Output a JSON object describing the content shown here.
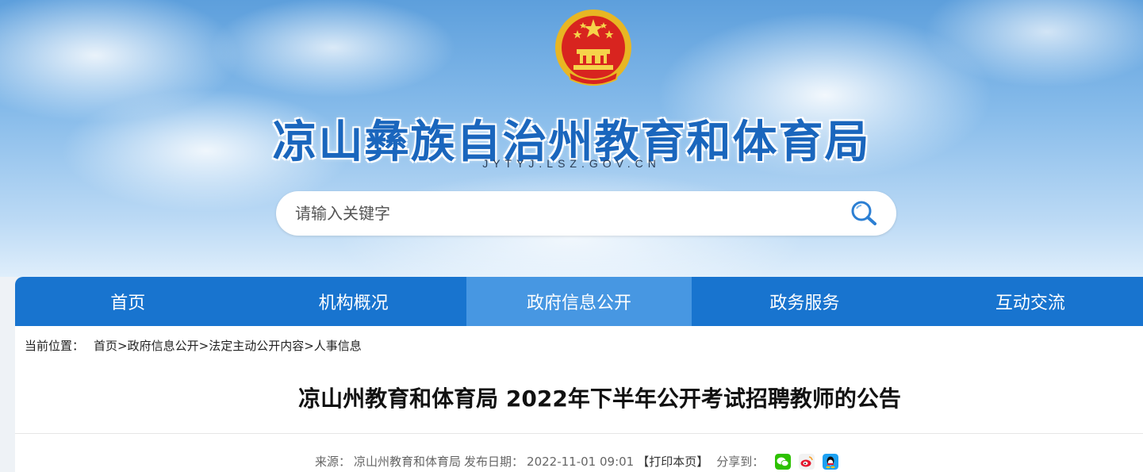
{
  "header": {
    "site_title": "凉山彝族自治州教育和体育局",
    "site_domain": "JYTYJ.LSZ.GOV.CN",
    "emblem_icon": "national-emblem-icon"
  },
  "search": {
    "placeholder": "请输入关键字",
    "icon": "search-icon"
  },
  "nav": {
    "items": [
      {
        "label": "首页"
      },
      {
        "label": "机构概况"
      },
      {
        "label": "政府信息公开"
      },
      {
        "label": "政务服务"
      },
      {
        "label": "互动交流"
      }
    ],
    "active_index": 2,
    "color": "#1874cf",
    "active_color": "#4797e2"
  },
  "breadcrumb": {
    "label": "当前位置：",
    "items": [
      "首页",
      "政府信息公开",
      "法定主动公开内容",
      "人事信息"
    ],
    "separator": ">"
  },
  "article": {
    "title": "凉山州教育和体育局 2022年下半年公开考试招聘教师的公告",
    "source_label": "来源：",
    "source": "凉山州教育和体育局",
    "date_label": "发布日期：",
    "date": "2022-11-01 09:01",
    "print": "【打印本页】",
    "share_label": "分享到：",
    "share_icons": [
      "wechat-icon",
      "weibo-icon",
      "qq-icon"
    ]
  }
}
